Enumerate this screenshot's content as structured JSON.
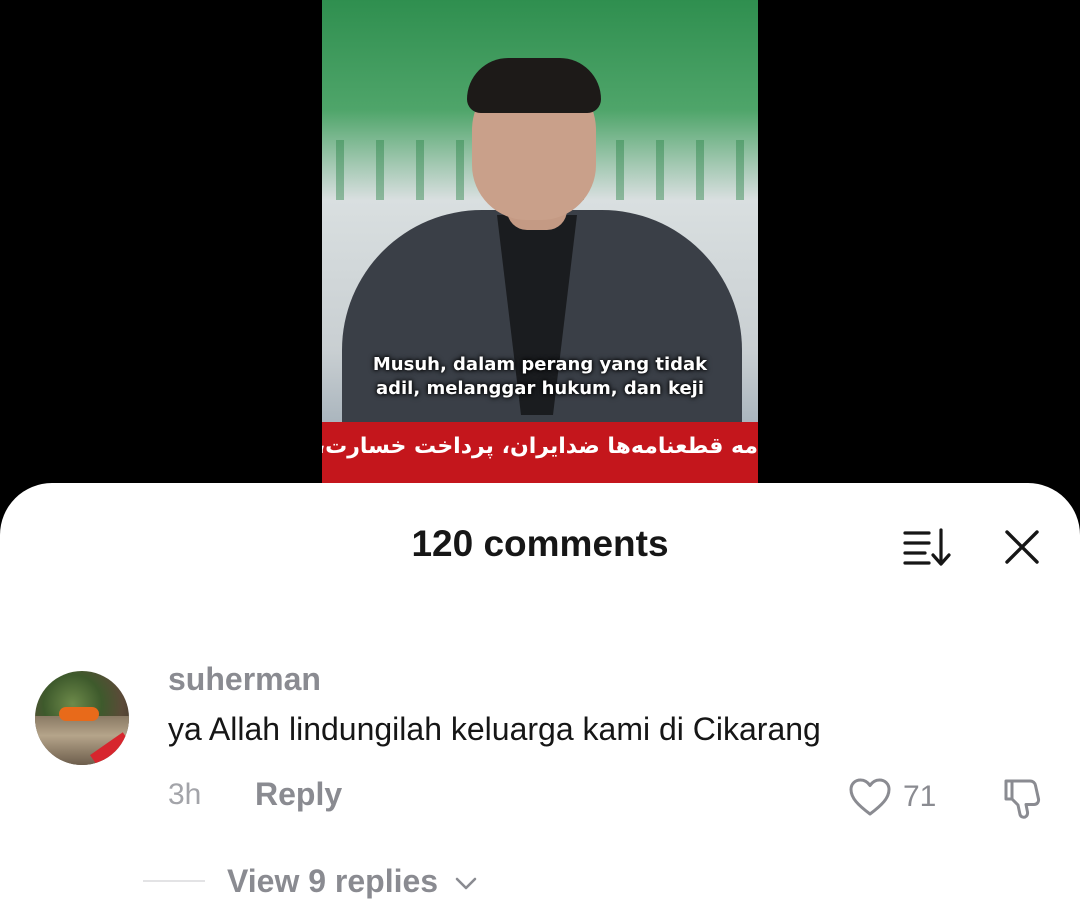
{
  "video": {
    "subtitle_line1": "Musuh, dalam perang yang tidak",
    "subtitle_line2": "adil, melanggar hukum, dan keji",
    "ticker_text": "مه قطعنامه‌ها ضدایران، پرداخت خسارت، خ"
  },
  "comments_sheet": {
    "title": "120 comments",
    "sort_icon": "sort-icon",
    "close_icon": "close-icon"
  },
  "comment": {
    "username": "suherman",
    "text": "ya Allah lindungilah keluarga kami di Cikarang",
    "time": "3h",
    "reply_label": "Reply",
    "like_count": "71",
    "view_replies_label": "View 9 replies"
  },
  "colors": {
    "sheet_background": "#ffffff",
    "ticker_red": "#c4161c",
    "muted_text": "#8a8b91"
  }
}
